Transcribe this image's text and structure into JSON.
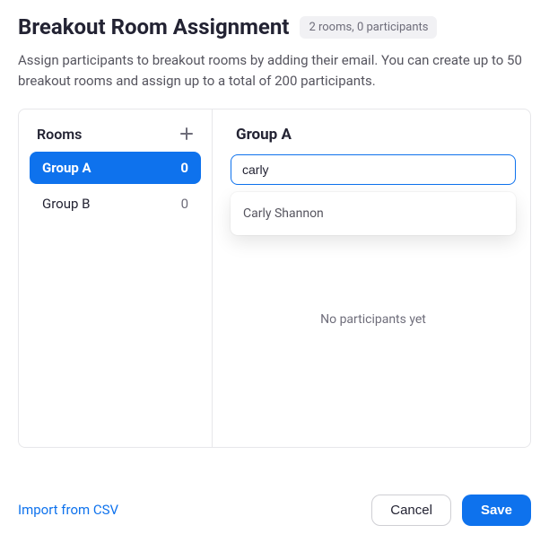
{
  "header": {
    "title": "Breakout Room Assignment",
    "summary": "2 rooms, 0 participants"
  },
  "description": "Assign participants to breakout rooms by adding their email. You can create up to 50 breakout rooms and assign up to a total of 200 participants.",
  "rooms_panel": {
    "heading": "Rooms",
    "items": [
      {
        "name": "Group A",
        "count": "0",
        "active": true
      },
      {
        "name": "Group B",
        "count": "0",
        "active": false
      }
    ]
  },
  "detail": {
    "title": "Group A",
    "search_value": "carly",
    "suggestions": [
      {
        "label": "Carly Shannon"
      }
    ],
    "empty_text": "No participants yet"
  },
  "footer": {
    "import_label": "Import from CSV",
    "cancel_label": "Cancel",
    "save_label": "Save"
  }
}
